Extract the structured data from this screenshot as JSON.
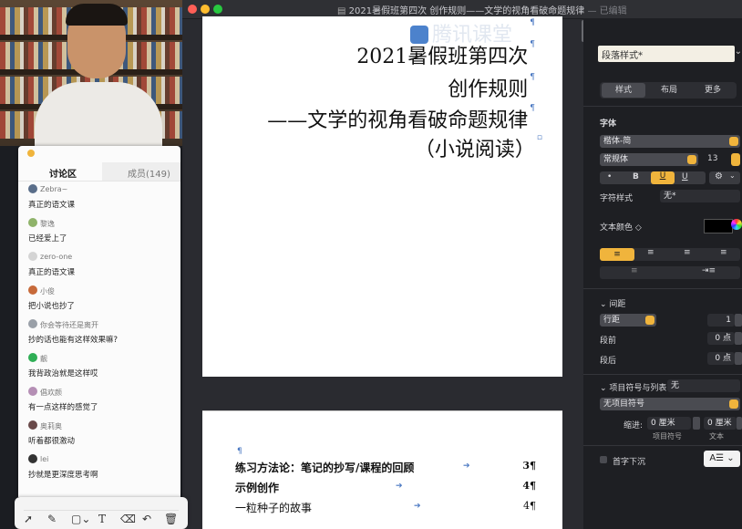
{
  "window": {
    "title": "2021暑假班第四次   创作规则——文学的视角看破命题规律",
    "status": "— 已编辑"
  },
  "document": {
    "title_lines": [
      "2021暑假班第四次",
      "创作规则",
      "——文学的视角看破命题规律",
      "（小说阅读）"
    ],
    "pilcrow": "¶",
    "toc": [
      {
        "text": "练习方法论：笔记的抄写/课程的回顾",
        "page": "3¶"
      },
      {
        "text": "示例创作",
        "page": "4¶"
      },
      {
        "text": "一粒种子的故事",
        "page": "4¶"
      }
    ]
  },
  "inspector": {
    "style_label": "段落样式*",
    "tabs": [
      "样式",
      "布局",
      "更多"
    ],
    "font_section": "字体",
    "font_family": "楷体-简",
    "font_weight": "常规体",
    "font_size": "13",
    "format_buttons": [
      "•",
      "B",
      "U",
      "U"
    ],
    "char_style_label": "字符样式",
    "char_style_value": "无*",
    "text_color_label": "文本颜色 ◇",
    "spacing_section": "间距",
    "line_spacing": "行距",
    "line_spacing_value": "1",
    "before_label": "段前",
    "before_value": "0 点",
    "after_label": "段后",
    "after_value": "0 点",
    "bullets_label": "项目符号与列表",
    "bullets_value": "无",
    "no_bullets": "无项目符号",
    "indent_label": "缩进:",
    "indent_bullet_value": "0 厘米",
    "indent_text_value": "0 厘米",
    "indent_bullet_caption": "项目符号",
    "indent_text_caption": "文本",
    "dropcap_label": "首字下沉"
  },
  "watermark": "腾讯课堂",
  "discussion": {
    "tabs": [
      "讨论区",
      "成员(149)"
    ],
    "messages": [
      {
        "user": "Zebra~",
        "text": "真正的语文课",
        "color": "#5a6e8a"
      },
      {
        "user": "黎逸",
        "text": "已经爱上了",
        "color": "#8fb36a"
      },
      {
        "user": "zero-one",
        "text": "真正的语文课",
        "color": "#c9c9c9"
      },
      {
        "user": "小俊",
        "text": "把小说也抄了",
        "color": "#c76a3a"
      },
      {
        "user": "你会等待还是离开",
        "text": "抄的话也能有这样效果嘛?",
        "color": "#9aa0a8"
      },
      {
        "user": "靓",
        "text": "我背政治就是这样哎",
        "color": "#2fae55"
      },
      {
        "user": "倡欢颜",
        "text": "有一点这样的感觉了",
        "color": "#b58fb5"
      },
      {
        "user": "奥莉奥",
        "text": "听着都很激动",
        "color": "#6a4a4a"
      },
      {
        "user": "lei",
        "text": "抄就是更深度思考啊",
        "color": "#333333"
      }
    ]
  },
  "drawbar": {
    "tools": [
      "pointer-tool",
      "pen-tool",
      "shape-tool",
      "text-tool",
      "eraser-tool",
      "undo-tool",
      "delete-tool"
    ]
  }
}
